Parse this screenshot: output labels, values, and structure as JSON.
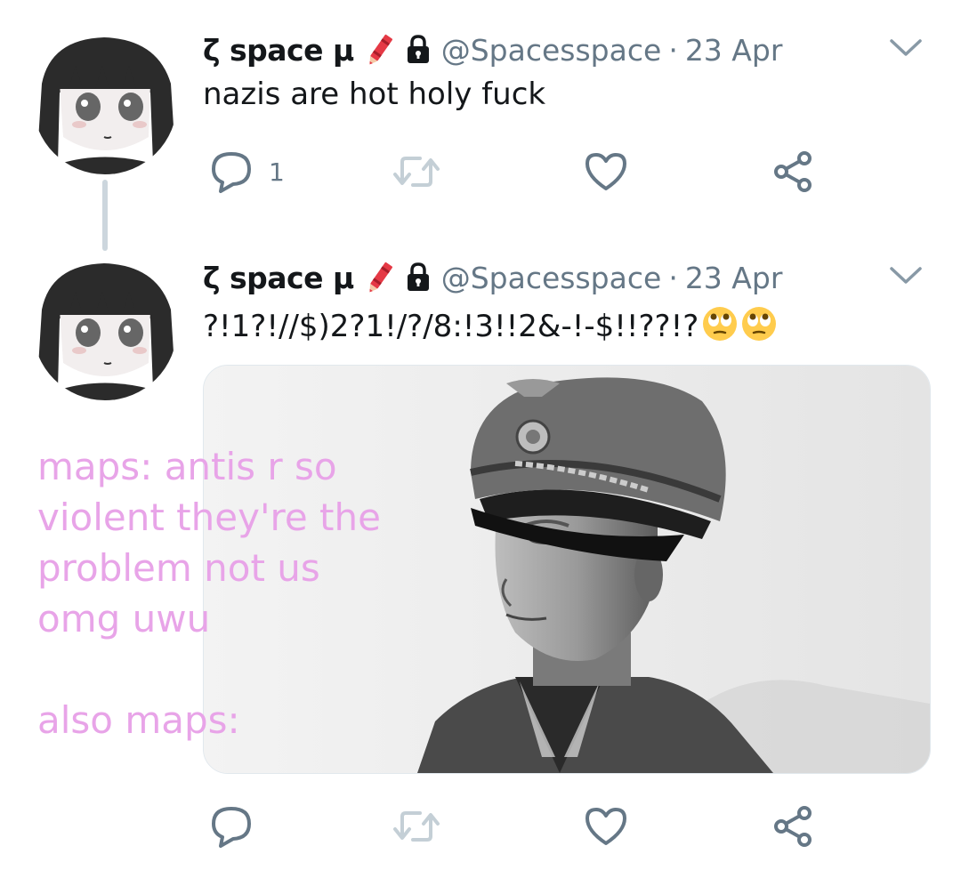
{
  "tweets": [
    {
      "display_name": "ζ space μ",
      "badges": [
        "crayon-icon",
        "lock-icon"
      ],
      "handle": "@Spacesspace",
      "separator": "·",
      "date": "23 Apr",
      "text": "nazis are hot holy fuck",
      "actions": {
        "reply_count": "1",
        "retweet_count": "",
        "like_count": ""
      }
    },
    {
      "display_name": "ζ space μ",
      "badges": [
        "crayon-icon",
        "lock-icon"
      ],
      "handle": "@Spacesspace",
      "separator": "·",
      "date": "23 Apr",
      "text": "?!1?!//$)2?1!/?/8:!3!!2&-!-$!!??!?",
      "emojis": [
        "face-with-rolling-eyes",
        "face-with-rolling-eyes"
      ],
      "media": "black-and-white photo of a man in a military peaked cap and uniform",
      "actions": {
        "reply_count": "",
        "retweet_count": "",
        "like_count": ""
      }
    }
  ],
  "overlay_caption": "maps: antis r so\nviolent they're the\nproblem not us\nomg uwu\n\nalso maps:",
  "colors": {
    "text_primary": "#14171a",
    "text_secondary": "#657786",
    "icon_gray": "#657786",
    "thread_line": "#ccd6dd",
    "overlay_pink": "#e8a4e8"
  }
}
